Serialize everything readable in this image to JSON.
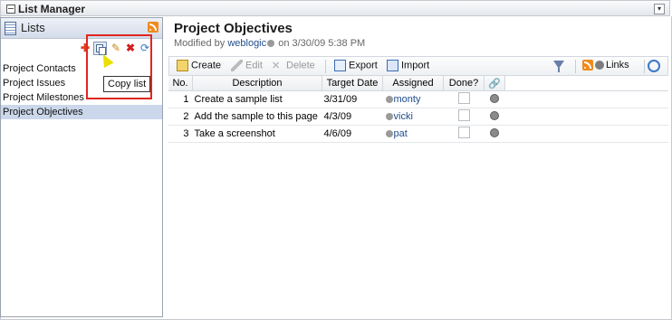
{
  "window": {
    "title": "List Manager"
  },
  "lists_panel": {
    "title": "Lists",
    "tooltip": "Copy list",
    "items": [
      {
        "label": "Project Contacts"
      },
      {
        "label": "Project Issues"
      },
      {
        "label": "Project Milestones"
      },
      {
        "label": "Project Objectives",
        "selected": true
      }
    ]
  },
  "main": {
    "title": "Project Objectives",
    "modified_prefix": "Modified by",
    "modified_user": "weblogic",
    "modified_suffix": "on 3/30/09 5:38 PM",
    "toolbar": {
      "create": "Create",
      "edit": "Edit",
      "delete": "Delete",
      "export": "Export",
      "import": "Import",
      "links": "Links"
    },
    "columns": [
      "No.",
      "Description",
      "Target Date",
      "Assigned",
      "Done?"
    ],
    "rows": [
      {
        "no": "1",
        "description": "Create a sample list",
        "target_date": "3/31/09",
        "assigned": "monty"
      },
      {
        "no": "2",
        "description": "Add the sample to this page",
        "target_date": "4/3/09",
        "assigned": "vicki"
      },
      {
        "no": "3",
        "description": "Take a screenshot",
        "target_date": "4/6/09",
        "assigned": "pat"
      }
    ]
  },
  "colors": {
    "accent": "#1f4d8c",
    "selection": "#cbd7ea",
    "highlight_box": "#e0261f"
  }
}
